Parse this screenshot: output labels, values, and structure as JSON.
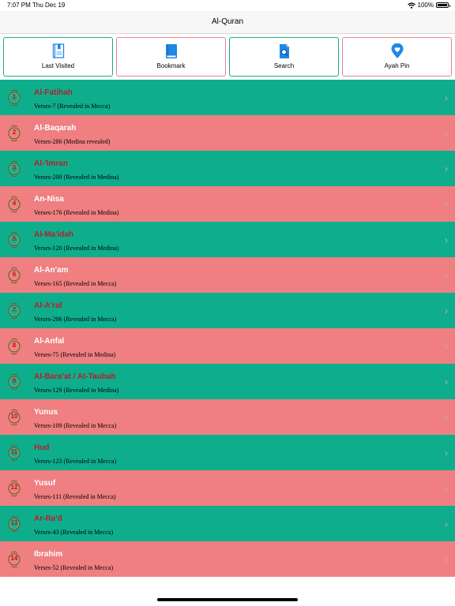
{
  "status_bar": {
    "time": "7:07 PM",
    "date": "Thu Dec 19",
    "battery": "100%"
  },
  "nav": {
    "title": "Al-Quran"
  },
  "toolbar": [
    {
      "label": "Last Visited",
      "icon": "book-icon",
      "border_color": "#1aab8a"
    },
    {
      "label": "Bookmark",
      "icon": "bookmark-book-icon",
      "border_color": "#e9848a"
    },
    {
      "label": "Search",
      "icon": "search-document-icon",
      "border_color": "#1aab8a"
    },
    {
      "label": "Ayah Pin",
      "icon": "map-pin-icon",
      "border_color": "#e9848a"
    }
  ],
  "colors": {
    "green": "#0eae8d",
    "pink": "#ef7f80",
    "name_on_green": "#b5202a",
    "name_on_pink": "#ffffff",
    "icon_blue": "#1e88e5"
  },
  "surahs": [
    {
      "number": "1",
      "name": "Al-Fatihah",
      "verses": "Verses-7   (Revealed in Mecca)"
    },
    {
      "number": "2",
      "name": "Al-Baqarah",
      "verses": "Verses-286 (Medina revealed)"
    },
    {
      "number": "3",
      "name": "Al-'Imran",
      "verses": "Verses-200 (Revealed in Medina)"
    },
    {
      "number": "4",
      "name": "An-Nisa",
      "verses": "Verses-176 (Revealed in Medina)"
    },
    {
      "number": "5",
      "name": "Al-Ma'idah",
      "verses": "Verses-120 (Revealed in Medina)"
    },
    {
      "number": "6",
      "name": "Al-An'am",
      "verses": "Verses-165 (Revealed in Mecca)"
    },
    {
      "number": "7",
      "name": "Al-A'raf",
      "verses": "Verses-206 (Revealed in Mecca)"
    },
    {
      "number": "8",
      "name": "Al-Anfal",
      "verses": "Verses-75   (Revealed in Medina)"
    },
    {
      "number": "9",
      "name": "Al-Bara'at / At-Taubah",
      "verses": "Verses-129 (Revealed in Medina)"
    },
    {
      "number": "10",
      "name": "Yunus",
      "verses": "Verses-109 (Revealed in Mecca)"
    },
    {
      "number": "11",
      "name": "Hud",
      "verses": "Verses-123 (Revealed in Mecca)"
    },
    {
      "number": "12",
      "name": "Yusuf",
      "verses": "Verses-111 (Revealed in Mecca)"
    },
    {
      "number": "13",
      "name": "Ar-Ra'd",
      "verses": "Verses-43   (Revealed in Mecca)"
    },
    {
      "number": "14",
      "name": "Ibrahim",
      "verses": "Verses-52   (Revealed in Mecca)"
    }
  ]
}
